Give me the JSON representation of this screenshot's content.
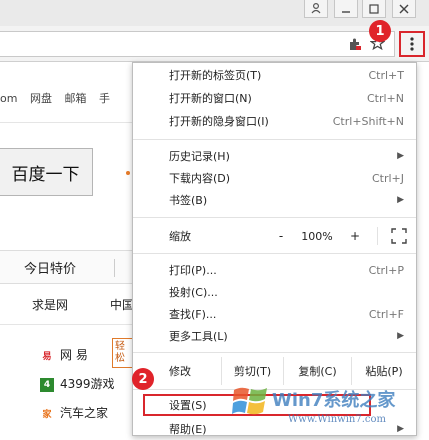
{
  "window": {
    "buttons": [
      "user-icon",
      "minimize-icon",
      "maximize-icon",
      "close-icon"
    ]
  },
  "toolbar": {
    "extension_icon": "puzzle-icon",
    "star_icon": "star-icon",
    "menu_icon": "kebab-menu-icon"
  },
  "badges": {
    "one": "1",
    "two": "2"
  },
  "page": {
    "nav": [
      "om",
      "网盘",
      "邮箱",
      "手"
    ],
    "search_button": "百度一下",
    "tab_label": "今日特价",
    "links": [
      "求是网",
      "中国"
    ],
    "sites": [
      {
        "icon": "易",
        "label": "网  易"
      },
      {
        "icon": "4",
        "label": "4399游戏"
      },
      {
        "icon": "家",
        "label": "汽车之家"
      }
    ],
    "side_tag": "轻松"
  },
  "menu": {
    "items": [
      {
        "label": "打开新的标签页(T)",
        "shortcut": "Ctrl+T"
      },
      {
        "label": "打开新的窗口(N)",
        "shortcut": "Ctrl+N"
      },
      {
        "label": "打开新的隐身窗口(I)",
        "shortcut": "Ctrl+Shift+N"
      },
      {
        "label": "历史记录(H)",
        "shortcut": ""
      },
      {
        "label": "下载内容(D)",
        "shortcut": "Ctrl+J"
      },
      {
        "label": "书签(B)",
        "shortcut": ""
      },
      {
        "label": "打印(P)...",
        "shortcut": "Ctrl+P"
      },
      {
        "label": "投射(C)...",
        "shortcut": ""
      },
      {
        "label": "查找(F)...",
        "shortcut": "Ctrl+F"
      },
      {
        "label": "更多工具(L)",
        "shortcut": ""
      },
      {
        "label": "设置(S)",
        "shortcut": ""
      },
      {
        "label": "帮助(E)",
        "shortcut": ""
      }
    ],
    "zoom": {
      "label": "缩放",
      "minus": "-",
      "value": "100%",
      "plus": "+"
    },
    "edit": {
      "label": "修改",
      "cut": "剪切(T)",
      "copy": "复制(C)",
      "paste": "粘贴(P)"
    }
  },
  "watermark": {
    "brand": "Win7系统之家",
    "url": "Www.Winwin7.com"
  },
  "colors": {
    "highlight": "#d9262c",
    "badge": "#e0232a"
  }
}
